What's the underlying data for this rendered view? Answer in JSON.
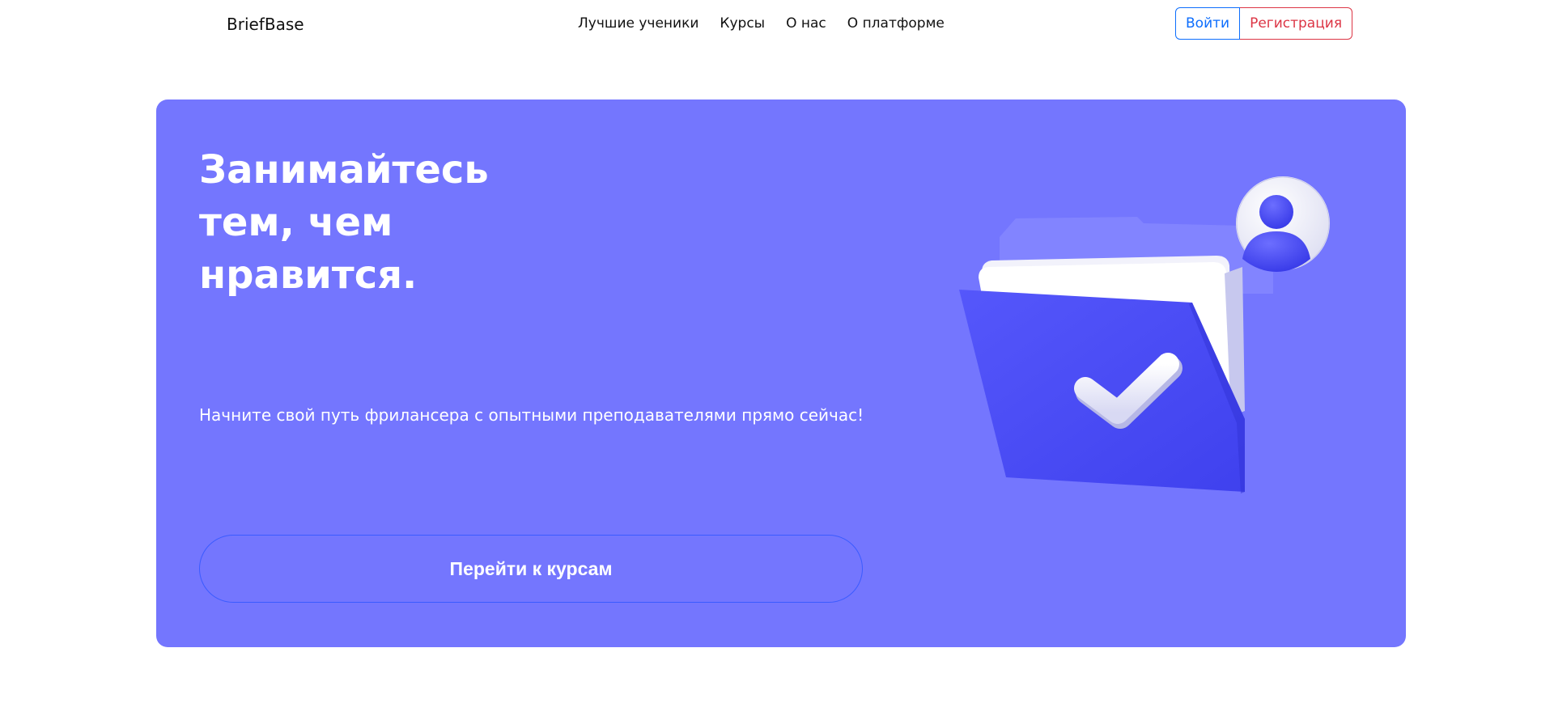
{
  "header": {
    "brand": "BriefBase",
    "nav": [
      {
        "label": "Лучшие ученики"
      },
      {
        "label": "Курсы"
      },
      {
        "label": "О нас"
      },
      {
        "label": "О платформе"
      }
    ],
    "login_label": "Войти",
    "register_label": "Регистрация"
  },
  "hero": {
    "title_lines": [
      "Занимайтесь",
      "тем, чем",
      "нравится."
    ],
    "subtitle": "Начните свой путь фрилансера с опытными преподавателями прямо сейчас!",
    "cta_label": "Перейти к курсам",
    "illustration_icons": [
      "folder-icon",
      "checkmark-icon",
      "user-avatar-icon"
    ]
  },
  "colors": {
    "hero_bg": "#7476fe",
    "folder": "#4b4df5",
    "login": "#0d6efd",
    "register": "#dc3545",
    "cta_border": "#3b5bff"
  }
}
